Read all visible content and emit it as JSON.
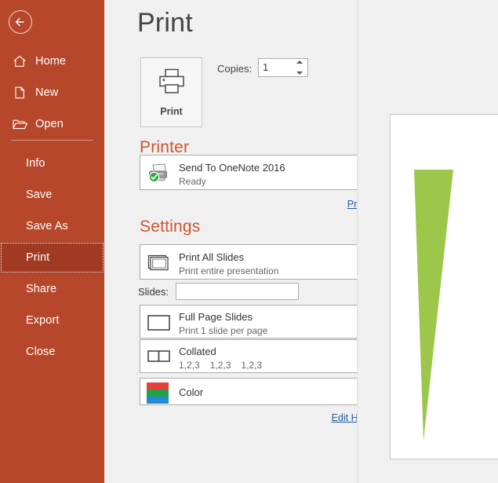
{
  "theme": {
    "sidebar_bg": "#b7472a",
    "sidebar_selected_bg": "#a03a22",
    "accent_heading": "#d2522e",
    "link_color": "#1f5aa6",
    "content_bg": "#f0f0f0",
    "slide_wedge_color": "#9cc74a"
  },
  "sidebar": {
    "back_button": "back-arrow",
    "top_items": [
      {
        "label": "Home",
        "icon": "home-icon"
      },
      {
        "label": "New",
        "icon": "new-document-icon"
      },
      {
        "label": "Open",
        "icon": "open-folder-icon"
      }
    ],
    "items": [
      {
        "label": "Info",
        "selected": false
      },
      {
        "label": "Save",
        "selected": false
      },
      {
        "label": "Save As",
        "selected": false
      },
      {
        "label": "Print",
        "selected": true
      },
      {
        "label": "Share",
        "selected": false
      },
      {
        "label": "Export",
        "selected": false
      },
      {
        "label": "Close",
        "selected": false
      }
    ]
  },
  "main": {
    "title": "Print",
    "print_button": {
      "label": "Print",
      "icon": "printer-icon"
    },
    "copies": {
      "label": "Copies:",
      "value": "1"
    },
    "printer_section": {
      "heading": "Printer",
      "info_icon": "info-icon",
      "selected": {
        "name": "Send To OneNote 2016",
        "status": "Ready",
        "icon": "printer-with-check-icon"
      },
      "properties_link": "Printer Properties"
    },
    "settings_section": {
      "heading": "Settings",
      "range": {
        "title": "Print All Slides",
        "subtitle": "Print entire presentation",
        "icon": "slides-stack-icon"
      },
      "slides_field": {
        "label": "Slides:",
        "value": "",
        "placeholder": "",
        "info_icon": "info-icon"
      },
      "layout": {
        "title": "Full Page Slides",
        "subtitle": "Print 1 slide per page",
        "icon": "full-page-slide-icon"
      },
      "collation": {
        "title": "Collated",
        "subtitle_parts": [
          "1,2,3",
          "1,2,3",
          "1,2,3"
        ],
        "icon": "collated-pages-icon"
      },
      "color": {
        "title": "Color",
        "icon": "color-swatch-icon",
        "swatch_colors": [
          "#e8403a",
          "#22a04c",
          "#2389d0"
        ]
      },
      "edit_header_footer_link": "Edit Header & Footer"
    }
  },
  "preview": {
    "slide": {
      "background": "#ffffff",
      "shape": "green-triangular-wedge"
    }
  }
}
